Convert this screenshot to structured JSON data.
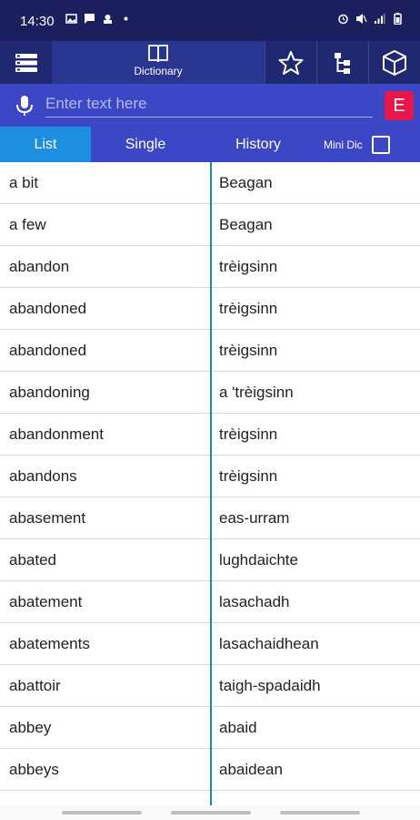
{
  "status": {
    "time": "14:30"
  },
  "toolbar": {
    "dictionary_label": "Dictionary"
  },
  "search": {
    "placeholder": "Enter text here",
    "lang_label": "E"
  },
  "tabs": {
    "list": "List",
    "single": "Single",
    "history": "History",
    "mini_dic": "Mini Dic"
  },
  "rows": [
    {
      "en": "a bit",
      "gd": "Beagan"
    },
    {
      "en": "a few",
      "gd": "Beagan"
    },
    {
      "en": "abandon",
      "gd": "trèigsinn"
    },
    {
      "en": "abandoned",
      "gd": "trèigsinn"
    },
    {
      "en": "abandoned",
      "gd": "trèigsinn"
    },
    {
      "en": "abandoning",
      "gd": "a 'trèigsinn"
    },
    {
      "en": "abandonment",
      "gd": "trèigsinn"
    },
    {
      "en": "abandons",
      "gd": "trèigsinn"
    },
    {
      "en": "abasement",
      "gd": "eas-urram"
    },
    {
      "en": "abated",
      "gd": "lughdaichte"
    },
    {
      "en": "abatement",
      "gd": "lasachadh"
    },
    {
      "en": "abatements",
      "gd": "lasachaidhean"
    },
    {
      "en": "abattoir",
      "gd": "taigh-spadaidh"
    },
    {
      "en": "abbey",
      "gd": "abaid"
    },
    {
      "en": "abbeys",
      "gd": "abaidean"
    }
  ]
}
